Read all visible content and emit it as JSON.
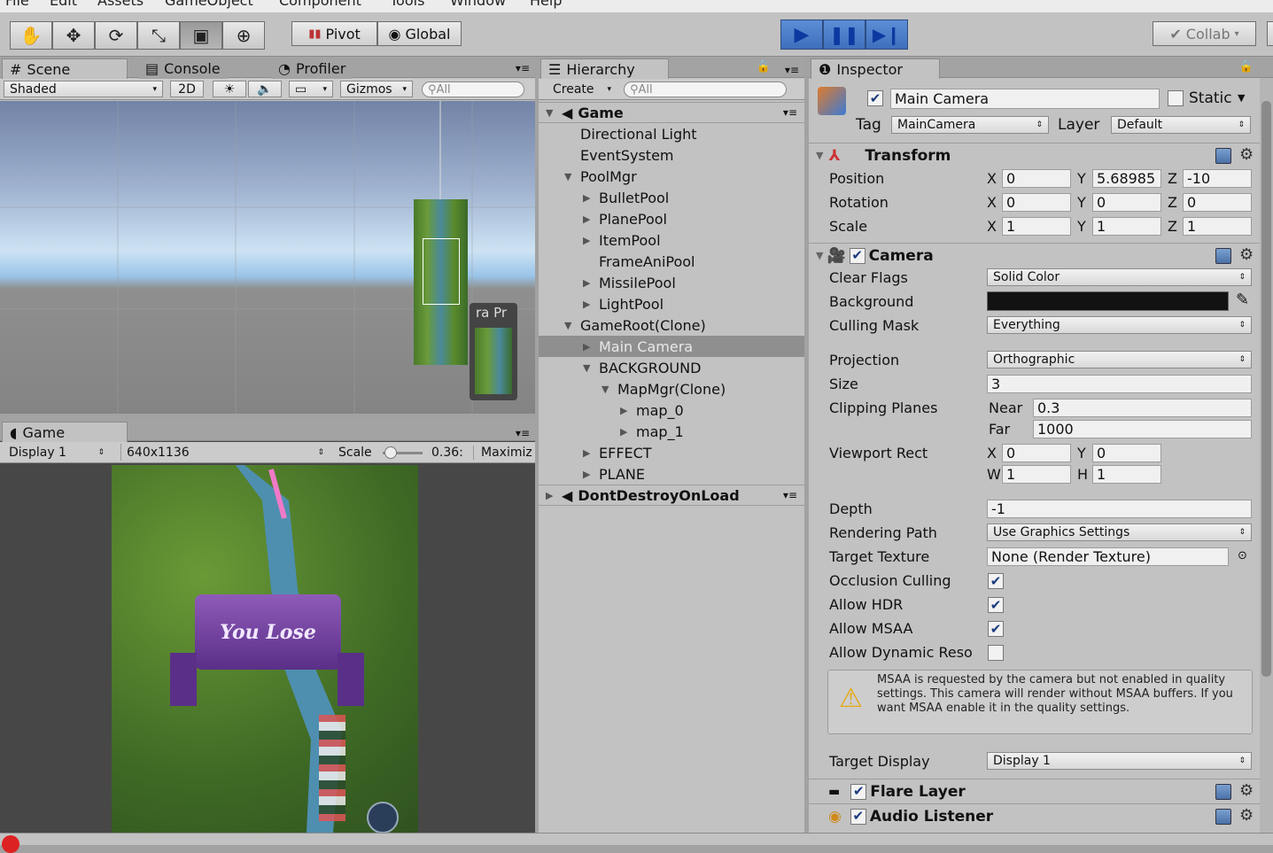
{
  "menu": [
    "File",
    "Edit",
    "Assets",
    "GameObject",
    "Component",
    "Tools",
    "Window",
    "Help"
  ],
  "toolbar": {
    "pivot_label": "Pivot",
    "global_label": "Global",
    "collab_label": "Collab"
  },
  "scene_panel": {
    "tabs": [
      "Scene",
      "Console",
      "Profiler"
    ],
    "shading_mode": "Shaded",
    "mode_2d": "2D",
    "gizmos_label": "Gizmos",
    "search_placeholder": "All",
    "preview_label": "ra Pr"
  },
  "game_panel": {
    "tab": "Game",
    "display": "Display 1",
    "resolution": "640x1136",
    "scale_label": "Scale",
    "scale_value": "0.36:",
    "maximize_label": "Maximiz",
    "banner_text": "You Lose"
  },
  "hierarchy": {
    "tab": "Hierarchy",
    "create_label": "Create",
    "search_placeholder": "All",
    "items": [
      {
        "label": "Game",
        "depth": 0,
        "arrow": "down",
        "scene": true
      },
      {
        "label": "Directional Light",
        "depth": 1,
        "arrow": "none"
      },
      {
        "label": "EventSystem",
        "depth": 1,
        "arrow": "none"
      },
      {
        "label": "PoolMgr",
        "depth": 1,
        "arrow": "down"
      },
      {
        "label": "BulletPool",
        "depth": 2,
        "arrow": "right"
      },
      {
        "label": "PlanePool",
        "depth": 2,
        "arrow": "right"
      },
      {
        "label": "ItemPool",
        "depth": 2,
        "arrow": "right"
      },
      {
        "label": "FrameAniPool",
        "depth": 2,
        "arrow": "none"
      },
      {
        "label": "MissilePool",
        "depth": 2,
        "arrow": "right"
      },
      {
        "label": "LightPool",
        "depth": 2,
        "arrow": "right"
      },
      {
        "label": "GameRoot(Clone)",
        "depth": 1,
        "arrow": "down"
      },
      {
        "label": "Main Camera",
        "depth": 2,
        "arrow": "right",
        "selected": true
      },
      {
        "label": "BACKGROUND",
        "depth": 2,
        "arrow": "down"
      },
      {
        "label": "MapMgr(Clone)",
        "depth": 3,
        "arrow": "down"
      },
      {
        "label": "map_0",
        "depth": 4,
        "arrow": "right"
      },
      {
        "label": "map_1",
        "depth": 4,
        "arrow": "right"
      },
      {
        "label": "EFFECT",
        "depth": 2,
        "arrow": "right"
      },
      {
        "label": "PLANE",
        "depth": 2,
        "arrow": "right"
      },
      {
        "label": "DontDestroyOnLoad",
        "depth": 0,
        "arrow": "right",
        "scene": true
      }
    ]
  },
  "inspector": {
    "tab": "Inspector",
    "object_name": "Main Camera",
    "static_label": "Static",
    "tag_label": "Tag",
    "tag_value": "MainCamera",
    "layer_label": "Layer",
    "layer_value": "Default",
    "transform": {
      "title": "Transform",
      "rows": [
        {
          "label": "Position",
          "x": "0",
          "y": "5.68985",
          "z": "-10"
        },
        {
          "label": "Rotation",
          "x": "0",
          "y": "0",
          "z": "0"
        },
        {
          "label": "Scale",
          "x": "1",
          "y": "1",
          "z": "1"
        }
      ]
    },
    "camera": {
      "title": "Camera",
      "clear_flags_label": "Clear Flags",
      "clear_flags": "Solid Color",
      "background_label": "Background",
      "background_color": "#121212",
      "culling_mask_label": "Culling Mask",
      "culling_mask": "Everything",
      "projection_label": "Projection",
      "projection": "Orthographic",
      "size_label": "Size",
      "size": "3",
      "clipping_label": "Clipping Planes",
      "near_label": "Near",
      "near": "0.3",
      "far_label": "Far",
      "far": "1000",
      "viewport_label": "Viewport Rect",
      "vp_x": "0",
      "vp_y": "0",
      "vp_w": "1",
      "vp_h": "1",
      "depth_label": "Depth",
      "depth": "-1",
      "rendering_path_label": "Rendering Path",
      "rendering_path": "Use Graphics Settings",
      "target_texture_label": "Target Texture",
      "target_texture": "None (Render Texture)",
      "occlusion_label": "Occlusion Culling",
      "hdr_label": "Allow HDR",
      "msaa_label": "Allow MSAA",
      "dynres_label": "Allow Dynamic Reso",
      "warning": "MSAA is requested by the camera but not enabled in quality settings. This camera will render without MSAA buffers. If you want MSAA enable it in the quality settings.",
      "target_display_label": "Target Display",
      "target_display": "Display 1"
    },
    "flare_layer": "Flare Layer",
    "audio_listener": "Audio Listener"
  }
}
